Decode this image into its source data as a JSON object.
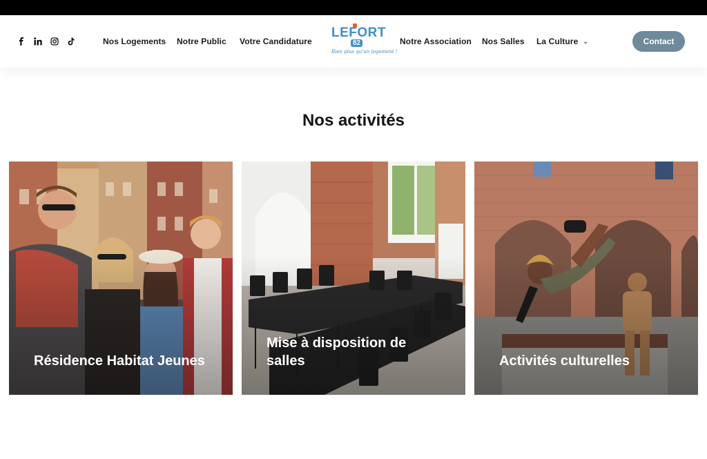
{
  "social": [
    {
      "name": "facebook-icon"
    },
    {
      "name": "linkedin-icon"
    },
    {
      "name": "instagram-icon"
    },
    {
      "name": "tiktok-icon"
    }
  ],
  "nav": {
    "left_items": [
      "Nos Logements",
      "Notre Public",
      "Votre Candidature"
    ],
    "right_items": [
      "Notre Association",
      "Nos Salles",
      "La Culture"
    ],
    "contact_label": "Contact"
  },
  "logo": {
    "main": "LEFORT",
    "number": "82",
    "tagline": "Bien plus qu'un logement !"
  },
  "section": {
    "title": "Nos activités"
  },
  "cards": [
    {
      "label": "Résidence Habitat Jeunes"
    },
    {
      "label": "Mise à disposition de salles"
    },
    {
      "label": "Activités culturelles"
    }
  ],
  "colors": {
    "accent": "#3f8fc4",
    "contact_button": "#6e8a9b",
    "top_bar": "#000000"
  }
}
